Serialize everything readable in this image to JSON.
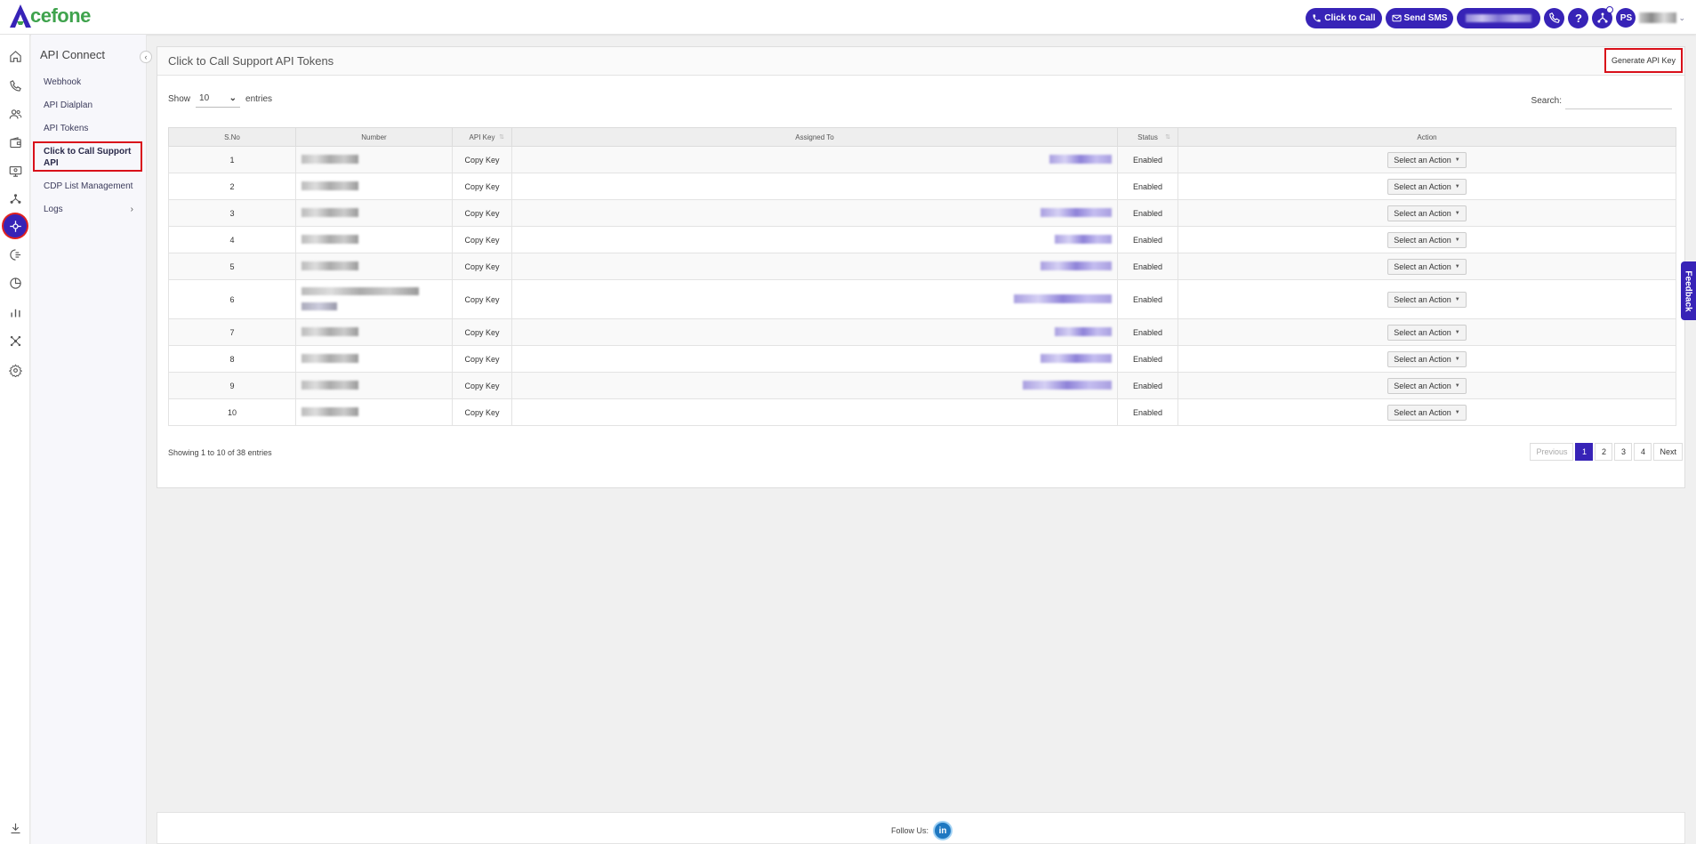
{
  "brand": {
    "name": "cefone",
    "colors": {
      "primary": "#3723b7",
      "logo_green": "#3fa34d",
      "highlight": "#d9101a"
    }
  },
  "topbar": {
    "click_to_call": "Click to Call",
    "send_sms": "Send SMS",
    "help": "?",
    "avatar": "PS",
    "icons": [
      "phone-icon",
      "mail-icon",
      "incoming-call-icon",
      "help-icon",
      "network-icon",
      "chevron-down-icon"
    ]
  },
  "rail": {
    "icons": [
      "home-icon",
      "phone-icon",
      "users-icon",
      "wallet-icon",
      "monitor-icon",
      "network-icon",
      "api-icon",
      "call-flow-icon",
      "pie-icon",
      "bar-chart-icon",
      "integrations-icon",
      "gear-icon",
      "download-icon"
    ]
  },
  "submenu": {
    "title": "API Connect",
    "items": [
      "Webhook",
      "API Dialplan",
      "API Tokens",
      "Click to Call Support API",
      "CDP List Management",
      "Logs"
    ]
  },
  "panel": {
    "title": "Click to Call Support API Tokens",
    "generate_btn": "Generate API Key",
    "show_label": "Show",
    "entries_label": "entries",
    "page_size": "10",
    "search_label": "Search:"
  },
  "table": {
    "columns": [
      "S.No",
      "Number",
      "API Key",
      "Assigned To",
      "Status",
      "Action"
    ],
    "rows": [
      {
        "sno": "1",
        "api_key": "Copy Key",
        "status": "Enabled",
        "action": "Select an Action"
      },
      {
        "sno": "2",
        "api_key": "Copy Key",
        "status": "Enabled",
        "action": "Select an Action"
      },
      {
        "sno": "3",
        "api_key": "Copy Key",
        "status": "Enabled",
        "action": "Select an Action"
      },
      {
        "sno": "4",
        "api_key": "Copy Key",
        "status": "Enabled",
        "action": "Select an Action"
      },
      {
        "sno": "5",
        "api_key": "Copy Key",
        "status": "Enabled",
        "action": "Select an Action"
      },
      {
        "sno": "6",
        "api_key": "Copy Key",
        "status": "Enabled",
        "action": "Select an Action"
      },
      {
        "sno": "7",
        "api_key": "Copy Key",
        "status": "Enabled",
        "action": "Select an Action"
      },
      {
        "sno": "8",
        "api_key": "Copy Key",
        "status": "Enabled",
        "action": "Select an Action"
      },
      {
        "sno": "9",
        "api_key": "Copy Key",
        "status": "Enabled",
        "action": "Select an Action"
      },
      {
        "sno": "10",
        "api_key": "Copy Key",
        "status": "Enabled",
        "action": "Select an Action"
      }
    ],
    "showing": "Showing 1 to 10 of 38 entries",
    "pagination": [
      "Previous",
      "1",
      "2",
      "3",
      "4",
      "Next"
    ]
  },
  "feedback": "Feedback",
  "footer": {
    "follow": "Follow Us:",
    "linkedin": "in"
  }
}
